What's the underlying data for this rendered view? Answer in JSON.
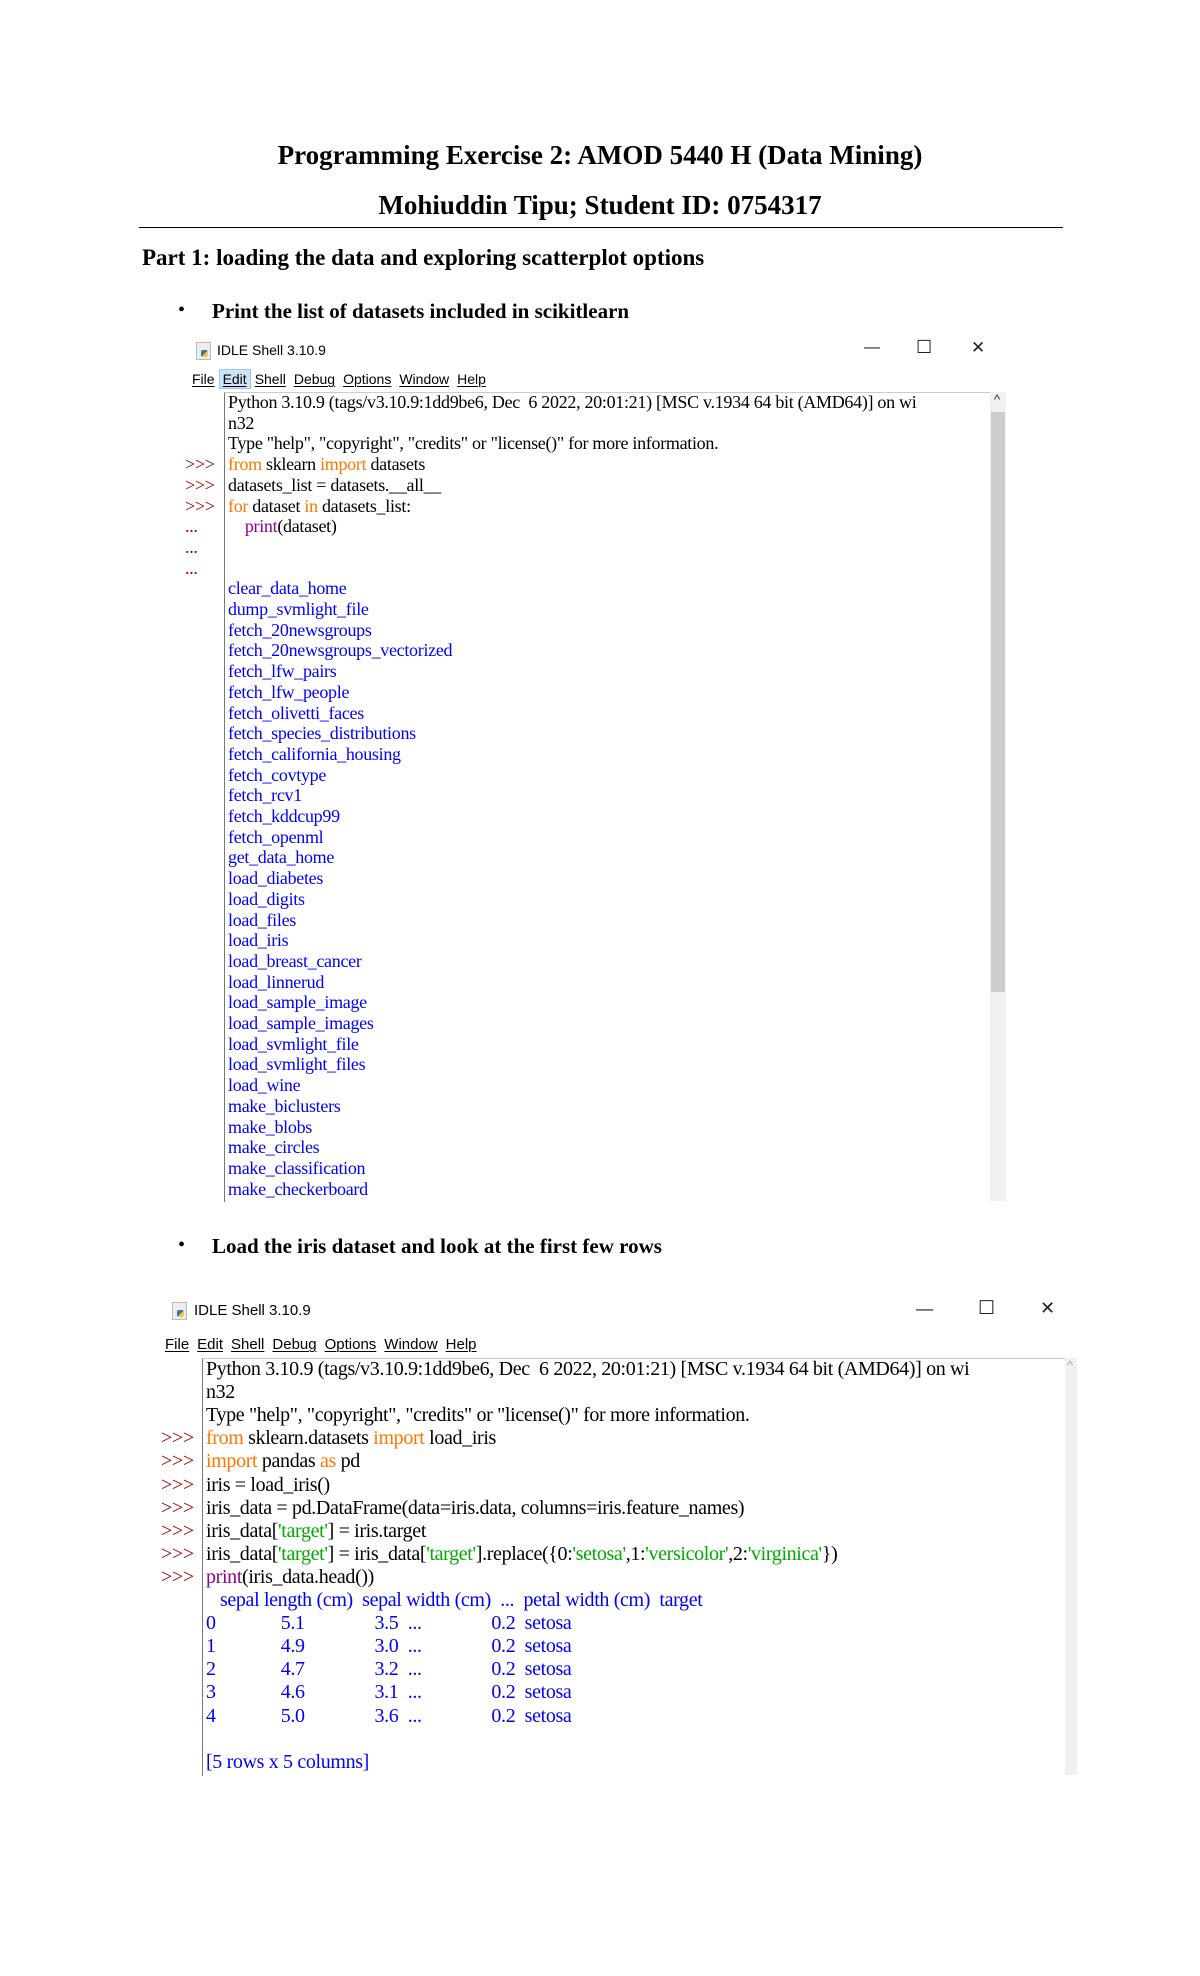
{
  "doc": {
    "title": "Programming Exercise 2: AMOD 5440 H (Data Mining)",
    "author_line": "Mohiuddin Tipu; Student ID: 0754317",
    "part1_heading": "Part 1: loading the data and exploring scatterplot options",
    "bullet1": "Print the list of datasets included in scikitlearn",
    "bullet2": "Load the iris dataset and look at the first few rows",
    "bullet_glyph": "•"
  },
  "colors": {
    "keyword": "#ff7700",
    "builtin": "#900090",
    "output": "#0000ff",
    "string": "#00aa00",
    "prompt": "#a00000"
  },
  "window1": {
    "title": "IDLE Shell 3.10.9",
    "controls": {
      "minimize": "—",
      "maximize": "☐",
      "close": "✕"
    },
    "menu": [
      "File",
      "Edit",
      "Shell",
      "Debug",
      "Options",
      "Window",
      "Help"
    ],
    "active_menu": "Edit",
    "scroll_up": "^",
    "lines": [
      {
        "p": "",
        "s": [
          [
            "def",
            "Python 3.10.9 (tags/v3.10.9:1dd9be6, Dec  6 2022, 20:01:21) [MSC v.1934 64 bit (AMD64)] on wi"
          ]
        ]
      },
      {
        "p": "",
        "s": [
          [
            "def",
            "n32"
          ]
        ]
      },
      {
        "p": "",
        "s": [
          [
            "def",
            "Type \"help\", \"copyright\", \"credits\" or \"license()\" for more information."
          ]
        ]
      },
      {
        "p": ">>>",
        "s": [
          [
            "kw",
            "from"
          ],
          [
            "def",
            " sklearn "
          ],
          [
            "kw",
            "import"
          ],
          [
            "def",
            " datasets"
          ]
        ]
      },
      {
        "p": ">>>",
        "s": [
          [
            "def",
            "datasets_list = datasets.__all__"
          ]
        ]
      },
      {
        "p": ">>>",
        "s": [
          [
            "kw",
            "for"
          ],
          [
            "def",
            " dataset "
          ],
          [
            "kw",
            "in"
          ],
          [
            "def",
            " datasets_list:"
          ]
        ]
      },
      {
        "p": "...",
        "s": [
          [
            "def",
            "    "
          ],
          [
            "bi",
            "print"
          ],
          [
            "def",
            "(dataset)"
          ]
        ]
      },
      {
        "p": "...",
        "s": []
      },
      {
        "p": "...",
        "s": []
      },
      {
        "p": "",
        "s": [
          [
            "out",
            "clear_data_home"
          ]
        ]
      },
      {
        "p": "",
        "s": [
          [
            "out",
            "dump_svmlight_file"
          ]
        ]
      },
      {
        "p": "",
        "s": [
          [
            "out",
            "fetch_20newsgroups"
          ]
        ]
      },
      {
        "p": "",
        "s": [
          [
            "out",
            "fetch_20newsgroups_vectorized"
          ]
        ]
      },
      {
        "p": "",
        "s": [
          [
            "out",
            "fetch_lfw_pairs"
          ]
        ]
      },
      {
        "p": "",
        "s": [
          [
            "out",
            "fetch_lfw_people"
          ]
        ]
      },
      {
        "p": "",
        "s": [
          [
            "out",
            "fetch_olivetti_faces"
          ]
        ]
      },
      {
        "p": "",
        "s": [
          [
            "out",
            "fetch_species_distributions"
          ]
        ]
      },
      {
        "p": "",
        "s": [
          [
            "out",
            "fetch_california_housing"
          ]
        ]
      },
      {
        "p": "",
        "s": [
          [
            "out",
            "fetch_covtype"
          ]
        ]
      },
      {
        "p": "",
        "s": [
          [
            "out",
            "fetch_rcv1"
          ]
        ]
      },
      {
        "p": "",
        "s": [
          [
            "out",
            "fetch_kddcup99"
          ]
        ]
      },
      {
        "p": "",
        "s": [
          [
            "out",
            "fetch_openml"
          ]
        ]
      },
      {
        "p": "",
        "s": [
          [
            "out",
            "get_data_home"
          ]
        ]
      },
      {
        "p": "",
        "s": [
          [
            "out",
            "load_diabetes"
          ]
        ]
      },
      {
        "p": "",
        "s": [
          [
            "out",
            "load_digits"
          ]
        ]
      },
      {
        "p": "",
        "s": [
          [
            "out",
            "load_files"
          ]
        ]
      },
      {
        "p": "",
        "s": [
          [
            "out",
            "load_iris"
          ]
        ]
      },
      {
        "p": "",
        "s": [
          [
            "out",
            "load_breast_cancer"
          ]
        ]
      },
      {
        "p": "",
        "s": [
          [
            "out",
            "load_linnerud"
          ]
        ]
      },
      {
        "p": "",
        "s": [
          [
            "out",
            "load_sample_image"
          ]
        ]
      },
      {
        "p": "",
        "s": [
          [
            "out",
            "load_sample_images"
          ]
        ]
      },
      {
        "p": "",
        "s": [
          [
            "out",
            "load_svmlight_file"
          ]
        ]
      },
      {
        "p": "",
        "s": [
          [
            "out",
            "load_svmlight_files"
          ]
        ]
      },
      {
        "p": "",
        "s": [
          [
            "out",
            "load_wine"
          ]
        ]
      },
      {
        "p": "",
        "s": [
          [
            "out",
            "make_biclusters"
          ]
        ]
      },
      {
        "p": "",
        "s": [
          [
            "out",
            "make_blobs"
          ]
        ]
      },
      {
        "p": "",
        "s": [
          [
            "out",
            "make_circles"
          ]
        ]
      },
      {
        "p": "",
        "s": [
          [
            "out",
            "make_classification"
          ]
        ]
      },
      {
        "p": "",
        "s": [
          [
            "out",
            "make_checkerboard"
          ]
        ]
      }
    ]
  },
  "window2": {
    "title": "IDLE Shell 3.10.9",
    "controls": {
      "minimize": "—",
      "maximize": "☐",
      "close": "✕"
    },
    "menu": [
      "File",
      "Edit",
      "Shell",
      "Debug",
      "Options",
      "Window",
      "Help"
    ],
    "scroll_up": "^",
    "lines": [
      {
        "p": "",
        "s": [
          [
            "def",
            "Python 3.10.9 (tags/v3.10.9:1dd9be6, Dec  6 2022, 20:01:21) [MSC v.1934 64 bit (AMD64)] on wi"
          ]
        ]
      },
      {
        "p": "",
        "s": [
          [
            "def",
            "n32"
          ]
        ]
      },
      {
        "p": "",
        "s": [
          [
            "def",
            "Type \"help\", \"copyright\", \"credits\" or \"license()\" for more information."
          ]
        ]
      },
      {
        "p": ">>>",
        "s": [
          [
            "kw",
            "from"
          ],
          [
            "def",
            " sklearn.datasets "
          ],
          [
            "kw",
            "import"
          ],
          [
            "def",
            " load_iris"
          ]
        ]
      },
      {
        "p": ">>>",
        "s": [
          [
            "kw",
            "import"
          ],
          [
            "def",
            " pandas "
          ],
          [
            "kw",
            "as"
          ],
          [
            "def",
            " pd"
          ]
        ]
      },
      {
        "p": ">>>",
        "s": [
          [
            "def",
            "iris = load_iris()"
          ]
        ]
      },
      {
        "p": ">>>",
        "s": [
          [
            "def",
            "iris_data = pd.DataFrame(data=iris.data, columns=iris.feature_names)"
          ]
        ]
      },
      {
        "p": ">>>",
        "s": [
          [
            "def",
            "iris_data["
          ],
          [
            "str",
            "'target'"
          ],
          [
            "def",
            "] = iris.target"
          ]
        ]
      },
      {
        "p": ">>>",
        "s": [
          [
            "def",
            "iris_data["
          ],
          [
            "str",
            "'target'"
          ],
          [
            "def",
            "] = iris_data["
          ],
          [
            "str",
            "'target'"
          ],
          [
            "def",
            "].replace({0:"
          ],
          [
            "str",
            "'setosa'"
          ],
          [
            "def",
            ",1:"
          ],
          [
            "str",
            "'versicolor'"
          ],
          [
            "def",
            ",2:"
          ],
          [
            "str",
            "'virginica'"
          ],
          [
            "def",
            "})"
          ]
        ]
      },
      {
        "p": ">>>",
        "s": [
          [
            "bi",
            "print"
          ],
          [
            "def",
            "(iris_data.head())"
          ]
        ]
      },
      {
        "p": "",
        "s": [
          [
            "out",
            "   sepal length (cm)  sepal width (cm)  ...  petal width (cm)  target"
          ]
        ]
      },
      {
        "p": "",
        "s": [
          [
            "out",
            "0              5.1               3.5  ...               0.2  setosa"
          ]
        ]
      },
      {
        "p": "",
        "s": [
          [
            "out",
            "1              4.9               3.0  ...               0.2  setosa"
          ]
        ]
      },
      {
        "p": "",
        "s": [
          [
            "out",
            "2              4.7               3.2  ...               0.2  setosa"
          ]
        ]
      },
      {
        "p": "",
        "s": [
          [
            "out",
            "3              4.6               3.1  ...               0.2  setosa"
          ]
        ]
      },
      {
        "p": "",
        "s": [
          [
            "out",
            "4              5.0               3.6  ...               0.2  setosa"
          ]
        ]
      },
      {
        "p": "",
        "s": []
      },
      {
        "p": "",
        "s": [
          [
            "out",
            "[5 rows x 5 columns]"
          ]
        ]
      }
    ]
  }
}
